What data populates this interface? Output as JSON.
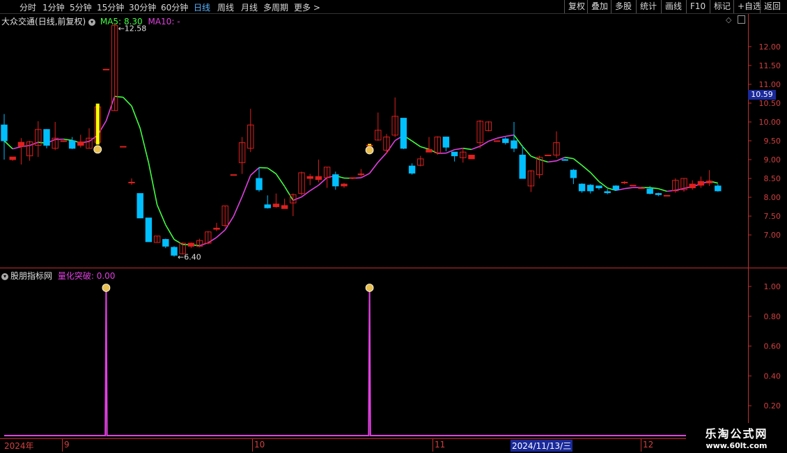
{
  "toolbar": {
    "timeframes": [
      "分时",
      "1分钟",
      "5分钟",
      "15分钟",
      "30分钟",
      "60分钟",
      "日线",
      "周线",
      "月线",
      "多周期",
      "更多 >"
    ],
    "active_index": 6,
    "right_buttons": [
      "复权",
      "叠加",
      "多股",
      "统计",
      "画线",
      "F10",
      "标记",
      "+自选",
      "返回"
    ]
  },
  "main_panel": {
    "stock_name": "大众交通",
    "period_note": "(日线,前复权)",
    "ma5_label": "MA5:",
    "ma5_value": "8.30",
    "ma10_label": "MA10:",
    "ma10_value": "-",
    "high_marker": "12.58",
    "low_marker": "6.40",
    "current_price": "10.59"
  },
  "indicator_panel": {
    "name": "股朋指标网",
    "series_label": "量化突破:",
    "series_value": "0.00"
  },
  "x_axis": {
    "labels": [
      "2024年",
      "9",
      "10",
      "11",
      "12"
    ],
    "cursor_date": "2024/11/13/三"
  },
  "watermark": {
    "title": "乐淘公式网",
    "url": "www.60lt.com"
  },
  "colors": {
    "up": "#e0201e",
    "down": "#00bfff",
    "ma_up": "#e040e0",
    "ma_down": "#40ff40",
    "signal": "#e040e0",
    "signal_bar": "#ffff00",
    "axis": "#c03030"
  },
  "chart_data": [
    {
      "type": "candlestick",
      "y_ticks": [
        7.0,
        7.5,
        8.0,
        8.5,
        9.0,
        9.5,
        10.0,
        10.5,
        11.0,
        11.5,
        12.0
      ],
      "ylim": [
        6.15,
        12.85
      ],
      "candles": [
        [
          9.92,
          9.5,
          10.21,
          9.0
        ],
        [
          9.0,
          9.07,
          9.07,
          8.97
        ],
        [
          9.35,
          9.46,
          9.57,
          8.87
        ],
        [
          9.1,
          9.47,
          9.5,
          8.97
        ],
        [
          9.38,
          9.8,
          10.02,
          9.07
        ],
        [
          9.8,
          9.38,
          9.81,
          9.3
        ],
        [
          9.3,
          9.57,
          10.0,
          9.25
        ],
        [
          9.5,
          9.5,
          9.5,
          9.47
        ],
        [
          9.5,
          9.3,
          9.6,
          9.28
        ],
        [
          9.38,
          9.47,
          9.66,
          9.32
        ],
        [
          9.3,
          9.57,
          9.83,
          9.3
        ],
        [
          9.46,
          10.4,
          10.45,
          9.4
        ],
        [
          11.4,
          11.4,
          11.4,
          11.4
        ],
        [
          10.3,
          12.56,
          12.58,
          10.3
        ],
        [
          9.35,
          9.35,
          9.35,
          9.35
        ],
        [
          8.4,
          8.4,
          8.5,
          8.33
        ],
        [
          8.1,
          7.45,
          8.1,
          7.45
        ],
        [
          7.45,
          6.82,
          7.45,
          6.82
        ],
        [
          6.8,
          6.97,
          6.97,
          6.8
        ],
        [
          6.88,
          6.7,
          6.9,
          6.65
        ],
        [
          6.67,
          6.46,
          6.7,
          6.42
        ],
        [
          6.5,
          6.78,
          6.8,
          6.48
        ],
        [
          6.7,
          6.78,
          6.8,
          6.65
        ],
        [
          6.7,
          6.85,
          6.9,
          6.67
        ],
        [
          6.78,
          7.08,
          7.1,
          6.75
        ],
        [
          7.15,
          7.18,
          7.32,
          7.1
        ],
        [
          7.25,
          7.77,
          7.78,
          7.2
        ],
        [
          8.6,
          8.6,
          8.6,
          8.6
        ],
        [
          8.92,
          9.45,
          9.6,
          8.62
        ],
        [
          9.3,
          9.92,
          10.35,
          9.2
        ],
        [
          8.5,
          8.2,
          8.8,
          8.15
        ],
        [
          7.8,
          7.72,
          8.05,
          7.7
        ],
        [
          7.75,
          7.82,
          8.1,
          7.72
        ],
        [
          7.7,
          7.78,
          7.96,
          7.7
        ],
        [
          7.85,
          8.07,
          8.1,
          7.5
        ],
        [
          8.1,
          8.65,
          8.68,
          8.05
        ],
        [
          8.5,
          8.55,
          8.62,
          8.32
        ],
        [
          8.47,
          8.55,
          9.0,
          8.4
        ],
        [
          8.52,
          8.8,
          8.8,
          8.25
        ],
        [
          8.6,
          8.3,
          8.68,
          8.2
        ],
        [
          8.3,
          8.35,
          8.38,
          8.25
        ],
        [
          8.52,
          8.52,
          8.52,
          8.48
        ],
        [
          8.6,
          8.62,
          8.75,
          8.55
        ],
        [
          9.38,
          9.38,
          9.38,
          9.38
        ],
        [
          9.52,
          9.78,
          10.25,
          9.5
        ],
        [
          9.25,
          9.6,
          9.68,
          9.15
        ],
        [
          9.65,
          10.15,
          10.65,
          9.6
        ],
        [
          10.1,
          9.3,
          10.1,
          9.28
        ],
        [
          8.83,
          8.64,
          8.9,
          8.6
        ],
        [
          8.85,
          9.02,
          9.1,
          8.82
        ],
        [
          9.2,
          9.27,
          9.6,
          9.2
        ],
        [
          9.18,
          9.6,
          9.62,
          9.13
        ],
        [
          9.6,
          9.33,
          9.6,
          9.22
        ],
        [
          9.2,
          9.1,
          9.12,
          8.95
        ],
        [
          9.05,
          9.2,
          9.3,
          8.92
        ],
        [
          9.02,
          9.12,
          9.12,
          9.08
        ],
        [
          9.45,
          10.02,
          10.05,
          9.3
        ],
        [
          9.77,
          10.0,
          10.02,
          9.75
        ],
        [
          9.5,
          9.5,
          9.5,
          9.5
        ],
        [
          9.55,
          9.45,
          9.6,
          9.4
        ],
        [
          9.5,
          9.3,
          10.0,
          9.2
        ],
        [
          9.12,
          8.5,
          9.38,
          8.5
        ],
        [
          8.3,
          8.7,
          8.72,
          8.14
        ],
        [
          8.6,
          9.06,
          9.1,
          8.5
        ],
        [
          9.12,
          9.12,
          9.12,
          9.12
        ],
        [
          9.12,
          9.45,
          9.75,
          9.05
        ],
        [
          9.0,
          8.98,
          9.02,
          8.98
        ],
        [
          8.72,
          8.52,
          8.75,
          8.35
        ],
        [
          8.35,
          8.17,
          8.37,
          8.12
        ],
        [
          8.32,
          8.17,
          8.35,
          8.1
        ],
        [
          8.3,
          8.25,
          8.3,
          8.2
        ],
        [
          8.15,
          8.12,
          8.22,
          8.08
        ],
        [
          8.3,
          8.2,
          8.32,
          8.17
        ],
        [
          8.4,
          8.4,
          8.43,
          8.35
        ],
        [
          8.32,
          8.32,
          8.32,
          8.32
        ],
        [
          8.25,
          8.25,
          8.25,
          8.22
        ],
        [
          8.22,
          8.1,
          8.3,
          8.08
        ],
        [
          8.1,
          8.07,
          8.12,
          8.03
        ],
        [
          8.05,
          8.05,
          8.05,
          8.03
        ],
        [
          8.17,
          8.45,
          8.5,
          8.12
        ],
        [
          8.2,
          8.5,
          8.5,
          8.15
        ],
        [
          8.25,
          8.35,
          8.45,
          8.2
        ],
        [
          8.32,
          8.42,
          8.55,
          8.25
        ],
        [
          8.38,
          8.43,
          8.72,
          8.3
        ],
        [
          8.3,
          8.17,
          8.35,
          8.15
        ]
      ],
      "signal_indices": [
        11,
        43
      ]
    },
    {
      "type": "line",
      "name": "量化突破",
      "y_ticks": [
        0.2,
        0.4,
        0.6,
        0.8,
        1.0
      ],
      "ylim": [
        0,
        1.07
      ],
      "x": [
        0,
        9,
        10,
        11,
        12,
        13,
        40,
        41,
        42,
        43,
        44,
        45,
        84
      ],
      "values": [
        0,
        0,
        0,
        0,
        1,
        0,
        0,
        0,
        0,
        1,
        0,
        0,
        0
      ]
    }
  ]
}
